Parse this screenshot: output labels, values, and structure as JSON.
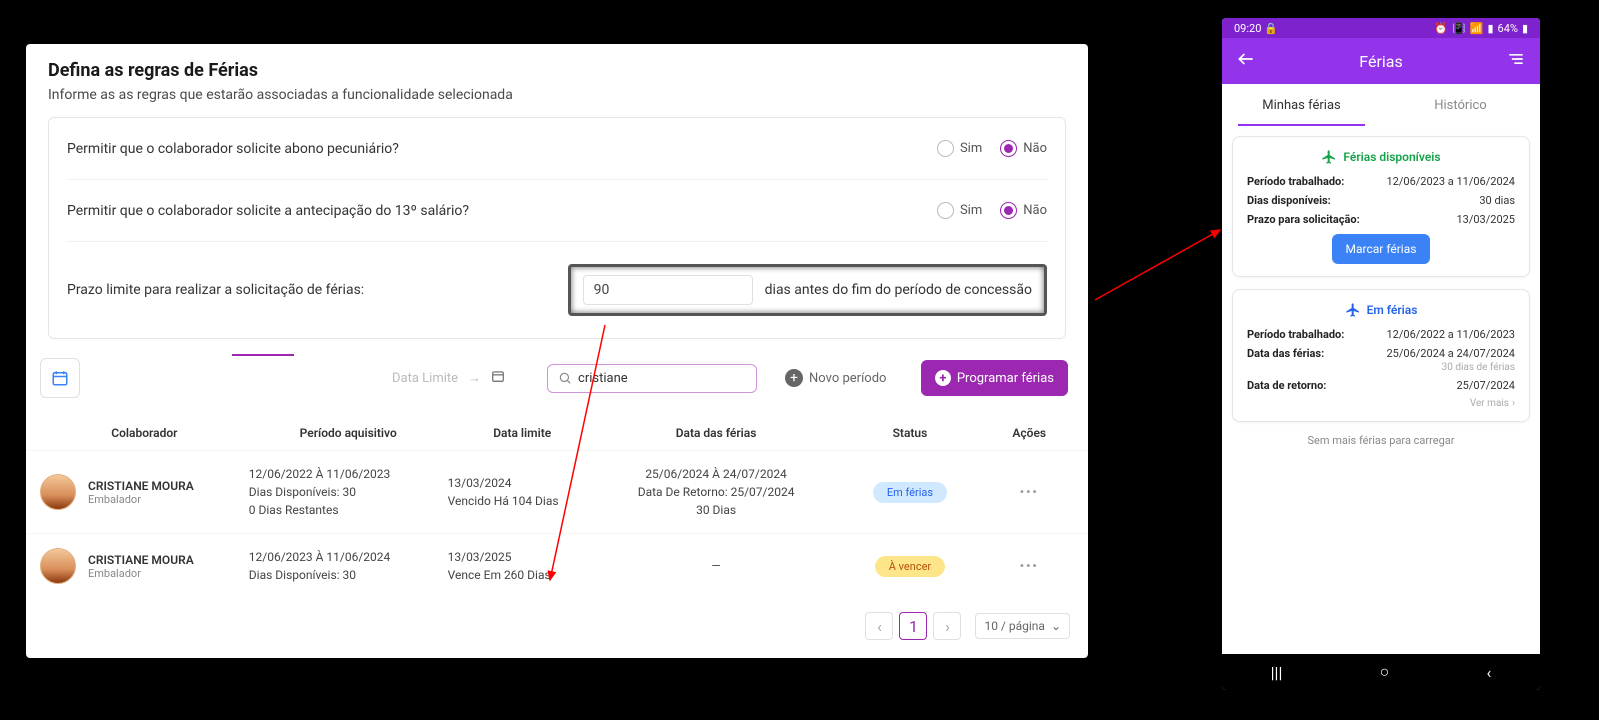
{
  "rules": {
    "title": "Defina as regras de Férias",
    "subtitle": "Informe as as regras que estarão associadas a funcionalidade selecionada",
    "q1": {
      "label": "Permitir que o colaborador solicite abono pecuniário?",
      "yes": "Sim",
      "no": "Não"
    },
    "q2": {
      "label": "Permitir que o colaborador solicite a antecipação do 13º salário?",
      "yes": "Sim",
      "no": "Não"
    },
    "deadline": {
      "label": "Prazo limite para realizar a solicitação de férias:",
      "value": "90",
      "suffix": "dias antes do fim do período de concessão"
    }
  },
  "toolbar": {
    "date_placeholder": "Data Limite",
    "arrow": "→",
    "search_value": "cristiane",
    "new_period": "Novo período",
    "program": "Programar férias"
  },
  "table": {
    "headers": {
      "colab": "Colaborador",
      "periodo": "Período aquisitivo",
      "limite": "Data limite",
      "ferias": "Data das férias",
      "status": "Status",
      "acoes": "Ações"
    },
    "rows": [
      {
        "name": "CRISTIANE MOURA",
        "role": "Embalador",
        "periodo_line1": "12/06/2022 À 11/06/2023",
        "periodo_line2": "Dias Disponíveis: 30",
        "periodo_line3": "0 Dias Restantes",
        "limite_line1": "13/03/2024",
        "limite_line2": "Vencido Há 104 Dias",
        "ferias_line1": "25/06/2024 À 24/07/2024",
        "ferias_line2": "Data De Retorno: 25/07/2024",
        "ferias_line3": "30 Dias",
        "status": "Em férias",
        "status_class": "badge-blue"
      },
      {
        "name": "CRISTIANE MOURA",
        "role": "Embalador",
        "periodo_line1": "12/06/2023 À 11/06/2024",
        "periodo_line2": "Dias Disponíveis: 30",
        "periodo_line3": "",
        "limite_line1": "13/03/2025",
        "limite_line2": "Vence Em 260 Dias",
        "ferias_line1": "—",
        "ferias_line2": "",
        "ferias_line3": "",
        "status": "À vencer",
        "status_class": "badge-yellow"
      }
    ],
    "footer": {
      "page": "1",
      "size": "10 / página"
    }
  },
  "mobile": {
    "status": {
      "time": "09:20",
      "battery": "64%"
    },
    "appbar_title": "Férias",
    "tabs": {
      "mine": "Minhas férias",
      "history": "Histórico"
    },
    "card1": {
      "title": "Férias disponíveis",
      "k1": "Período trabalhado:",
      "v1": "12/06/2023 a 11/06/2024",
      "k2": "Dias disponíveis:",
      "v2": "30 dias",
      "k3": "Prazo para solicitação:",
      "v3": "13/03/2025",
      "button": "Marcar férias"
    },
    "card2": {
      "title": "Em férias",
      "k1": "Período trabalhado:",
      "v1": "12/06/2022 a 11/06/2023",
      "k2": "Data das férias:",
      "v2": "25/06/2024 a 24/07/2024",
      "v2sub": "30 dias de férias",
      "k3": "Data de retorno:",
      "v3": "25/07/2024",
      "see_more": "Ver mais"
    },
    "no_more": "Sem mais férias para carregar"
  }
}
